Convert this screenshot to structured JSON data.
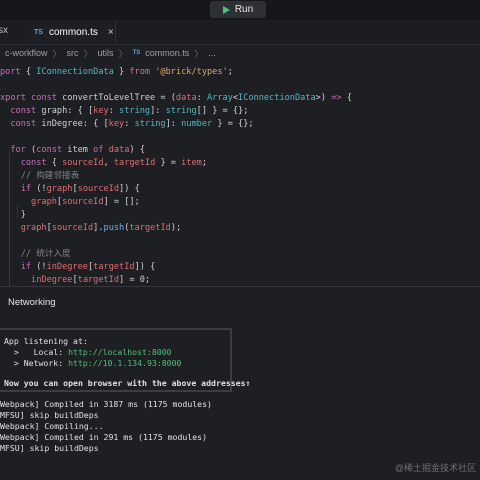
{
  "toolbar": {
    "run_label": "Run"
  },
  "tabs": {
    "inactive_label": "sx",
    "active_label": "common.ts",
    "ts_badge": "TS",
    "close_glyph": "×"
  },
  "breadcrumb": {
    "items": [
      "c-workflow",
      "src",
      "utils",
      "common.ts",
      "..."
    ],
    "separator": "〉",
    "ts_badge": "TS"
  },
  "code_lines": [
    [
      "pl:",
      "kw:port ",
      "pl:{ ",
      "ty:IConnectionData",
      "pl: } ",
      "kw:from ",
      "str:'@brick/types'",
      "pl:;"
    ],
    [],
    [
      "kw:xport const ",
      "pl:convertToLevelTree = (",
      "pr:data",
      "pl:: ",
      "ty:Array",
      "pl:<",
      "ty:IConnectionData",
      "pl:>) ",
      "kw:=> ",
      "pl:{"
    ],
    [
      "kw:  const ",
      "pl:graph: { [",
      "pr:key",
      "pl:: ",
      "ty:string",
      "pl:]: ",
      "ty:string",
      "pl:[] } = {};"
    ],
    [
      "kw:  const ",
      "pl:inDegree: { [",
      "pr:key",
      "pl:: ",
      "ty:string",
      "pl:]: ",
      "ty:number",
      "pl: } = {};"
    ],
    [],
    [
      "kw:  for ",
      "pl:(",
      "kw:const ",
      "pl:item ",
      "kw:of ",
      "pr:data",
      "pl:) {"
    ],
    [
      "kw:    const ",
      "pl:{ ",
      "pr:sourceId",
      "pl:, ",
      "pr:targetId",
      "pl: } = ",
      "pr:item",
      "pl:;"
    ],
    [
      "cm:    // 构建邻接表"
    ],
    [
      "kw:    if ",
      "pl:(!",
      "pr:graph",
      "pl:[",
      "pr:sourceId",
      "pl:]) {"
    ],
    [
      "pl:      ",
      "pr:graph",
      "pl:[",
      "pr:sourceId",
      "pl:] = [];"
    ],
    [
      "pl:    }"
    ],
    [
      "pl:    ",
      "pr:graph",
      "pl:[",
      "pr:sourceId",
      "pl:].",
      "bl:push",
      "pl:(",
      "pr:targetId",
      "pl:);"
    ],
    [],
    [
      "cm:    // 统计入度"
    ],
    [
      "kw:    if ",
      "pl:(!",
      "pr:inDegree",
      "pl:[",
      "pr:targetId",
      "pl:]) {"
    ],
    [
      "pl:      ",
      "pr:inDegree",
      "pl:[",
      "pr:targetId",
      "pl:] = 0;"
    ]
  ],
  "panel": {
    "title": "Networking"
  },
  "terminal": {
    "listening": "App listening at:",
    "local_label": "  >   Local: ",
    "local_url": "http://localhost:8000",
    "network_label": "  > Network: ",
    "network_url": "http://10.1.134.93:8000",
    "open_msg": "Now you can open browser with the above addresses↑",
    "log_lines": [
      "Webpack] Compiled in 3187 ms (1175 modules)",
      "MFSU] skip buildDeps",
      "Webpack] Compiling...",
      "Webpack] Compiled in 291 ms (1175 modules)",
      "MFSU] skip buildDeps"
    ]
  },
  "watermark": "@稀土掘金技术社区"
}
